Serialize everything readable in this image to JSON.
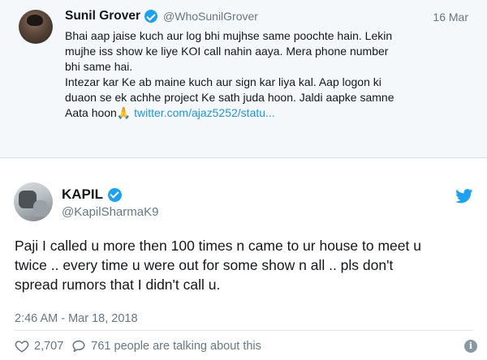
{
  "tweet1": {
    "name": "Sunil Grover",
    "handle": "@WhoSunilGrover",
    "date": "16 Mar",
    "text_main": "Bhai aap jaise kuch aur log bhi mujhse same poochte hain. Lekin\nmujhe iss show ke liye KOI call nahin aaya. Mera phone number\nbhi same hai.\nIntezar kar Ke ab maine kuch aur sign kar liya kal. Aap logon ki\nduaon se ek achhe project Ke sath juda hoon. Jaldi aapke samne\nAata hoon",
    "emoji": "🙏",
    "link": "twitter.com/ajaz5252/statu..."
  },
  "tweet2": {
    "name": "KAPIL",
    "handle": "@KapilSharmaK9",
    "text": "Paji I called u more then 100 times n came to ur house to meet u\ntwice .. every time u were out for some show n all .. pls don't\nspread rumors that I didn't call u.",
    "timestamp": "2:46 AM - Mar 18, 2018",
    "likes": "2,707",
    "talking": "761 people are talking about this",
    "info": "i"
  },
  "colors": {
    "twitter_blue": "#1da1f2",
    "link_blue": "#1b95e0",
    "muted": "#657786",
    "embed_bg": "#f5f8fa"
  }
}
